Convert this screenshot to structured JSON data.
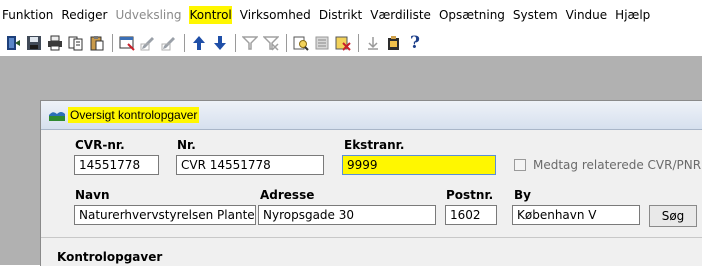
{
  "menu": {
    "items": [
      {
        "label": "Funktion"
      },
      {
        "label": "Rediger"
      },
      {
        "label": "Udveksling"
      },
      {
        "label": "Kontrol"
      },
      {
        "label": "Virksomhed"
      },
      {
        "label": "Distrikt"
      },
      {
        "label": "Værdiliste"
      },
      {
        "label": "Opsætning"
      },
      {
        "label": "System"
      },
      {
        "label": "Vindue"
      },
      {
        "label": "Hjælp"
      }
    ]
  },
  "toolbar": {
    "icons": [
      "exit-icon",
      "save-icon",
      "print-icon",
      "copy-icon",
      "paste-icon",
      "new-record-icon",
      "edit-icon",
      "edit2-icon",
      "arrow-up-icon",
      "arrow-down-icon",
      "filter-icon",
      "clear-filter-icon",
      "search-doc-icon",
      "list-icon",
      "delete-doc-icon",
      "download-icon",
      "clipboard-icon",
      "help-icon"
    ],
    "help_glyph": "?"
  },
  "window": {
    "title": "Oversigt kontrolopgaver",
    "cvr_label": "CVR-nr.",
    "cvr_value": "14551778",
    "nr_label": "Nr.",
    "nr_value": "CVR 14551778",
    "ekstranr_label": "Ekstranr.",
    "ekstranr_value": "9999",
    "checkbox_label": "Medtag relaterede CVR/PNR",
    "navn_label": "Navn",
    "navn_value": "Naturerhvervstyrelsen Plante",
    "adresse_label": "Adresse",
    "adresse_value": "Nyropsgade 30",
    "postnr_label": "Postnr.",
    "postnr_value": "1602",
    "by_label": "By",
    "by_value": "København V",
    "search_button": "Søg",
    "section_label": "Kontrolopgaver"
  },
  "colors": {
    "highlight": "#fff700",
    "workspace": "#b1b1b1",
    "form_bg": "#f0f0f0"
  }
}
